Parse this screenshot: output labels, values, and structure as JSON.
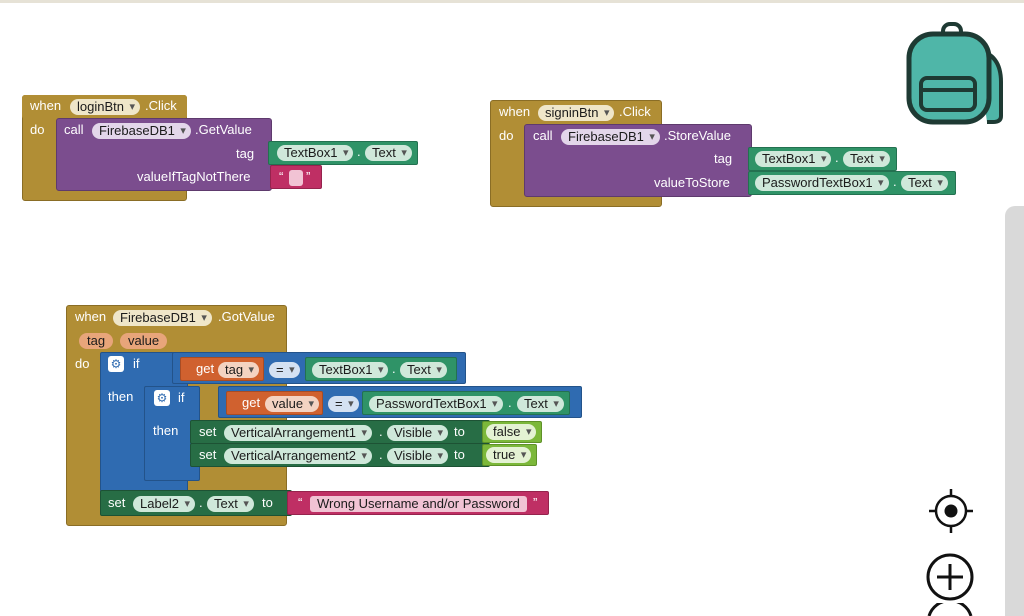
{
  "block_labels": {
    "when": "when",
    "do": "do",
    "call": "call",
    "if": "if",
    "then": "then",
    "get": "get",
    "set": "set",
    "to": "to",
    "dot": ".",
    "eq": "=",
    "quote_open": "“",
    "quote_close": "”"
  },
  "login_block": {
    "component": "loginBtn",
    "event": ".Click",
    "call_component": "FirebaseDB1",
    "method": ".GetValue",
    "arg1_label": "tag",
    "arg1_component": "TextBox1",
    "arg1_property": "Text",
    "arg2_label": "valueIfTagNotThere",
    "arg2_value": ""
  },
  "signin_block": {
    "component": "signinBtn",
    "event": ".Click",
    "call_component": "FirebaseDB1",
    "method": ".StoreValue",
    "arg1_label": "tag",
    "arg1_component": "TextBox1",
    "arg1_property": "Text",
    "arg2_label": "valueToStore",
    "arg2_component": "PasswordTextBox1",
    "arg2_property": "Text"
  },
  "gotvalue_block": {
    "component": "FirebaseDB1",
    "event": ".GotValue",
    "param1": "tag",
    "param2": "value",
    "if1_var": "tag",
    "if1_component": "TextBox1",
    "if1_property": "Text",
    "if2_var": "value",
    "if2_component": "PasswordTextBox1",
    "if2_property": "Text",
    "set1_component": "VerticalArrangement1",
    "set1_property": "Visible",
    "set1_value": "false",
    "set2_component": "VerticalArrangement2",
    "set2_property": "Visible",
    "set2_value": "true",
    "set3_component": "Label2",
    "set3_property": "Text",
    "set3_value": "Wrong Username and/or Password"
  },
  "icons": {
    "backpack": "backpack-icon",
    "center": "crosshair-target-icon",
    "zoom_in": "zoom-in-icon",
    "zoom_out": "zoom-out-icon"
  },
  "colors": {
    "event": "#b18e35",
    "call": "#7b4d8e",
    "control": "#2f6bb1",
    "component_property": "#2f9367",
    "setter": "#276d45",
    "text": "#bf2f64",
    "variable": "#d0612f",
    "logic": "#7cb83a",
    "backpack": "#4fb6a8"
  }
}
